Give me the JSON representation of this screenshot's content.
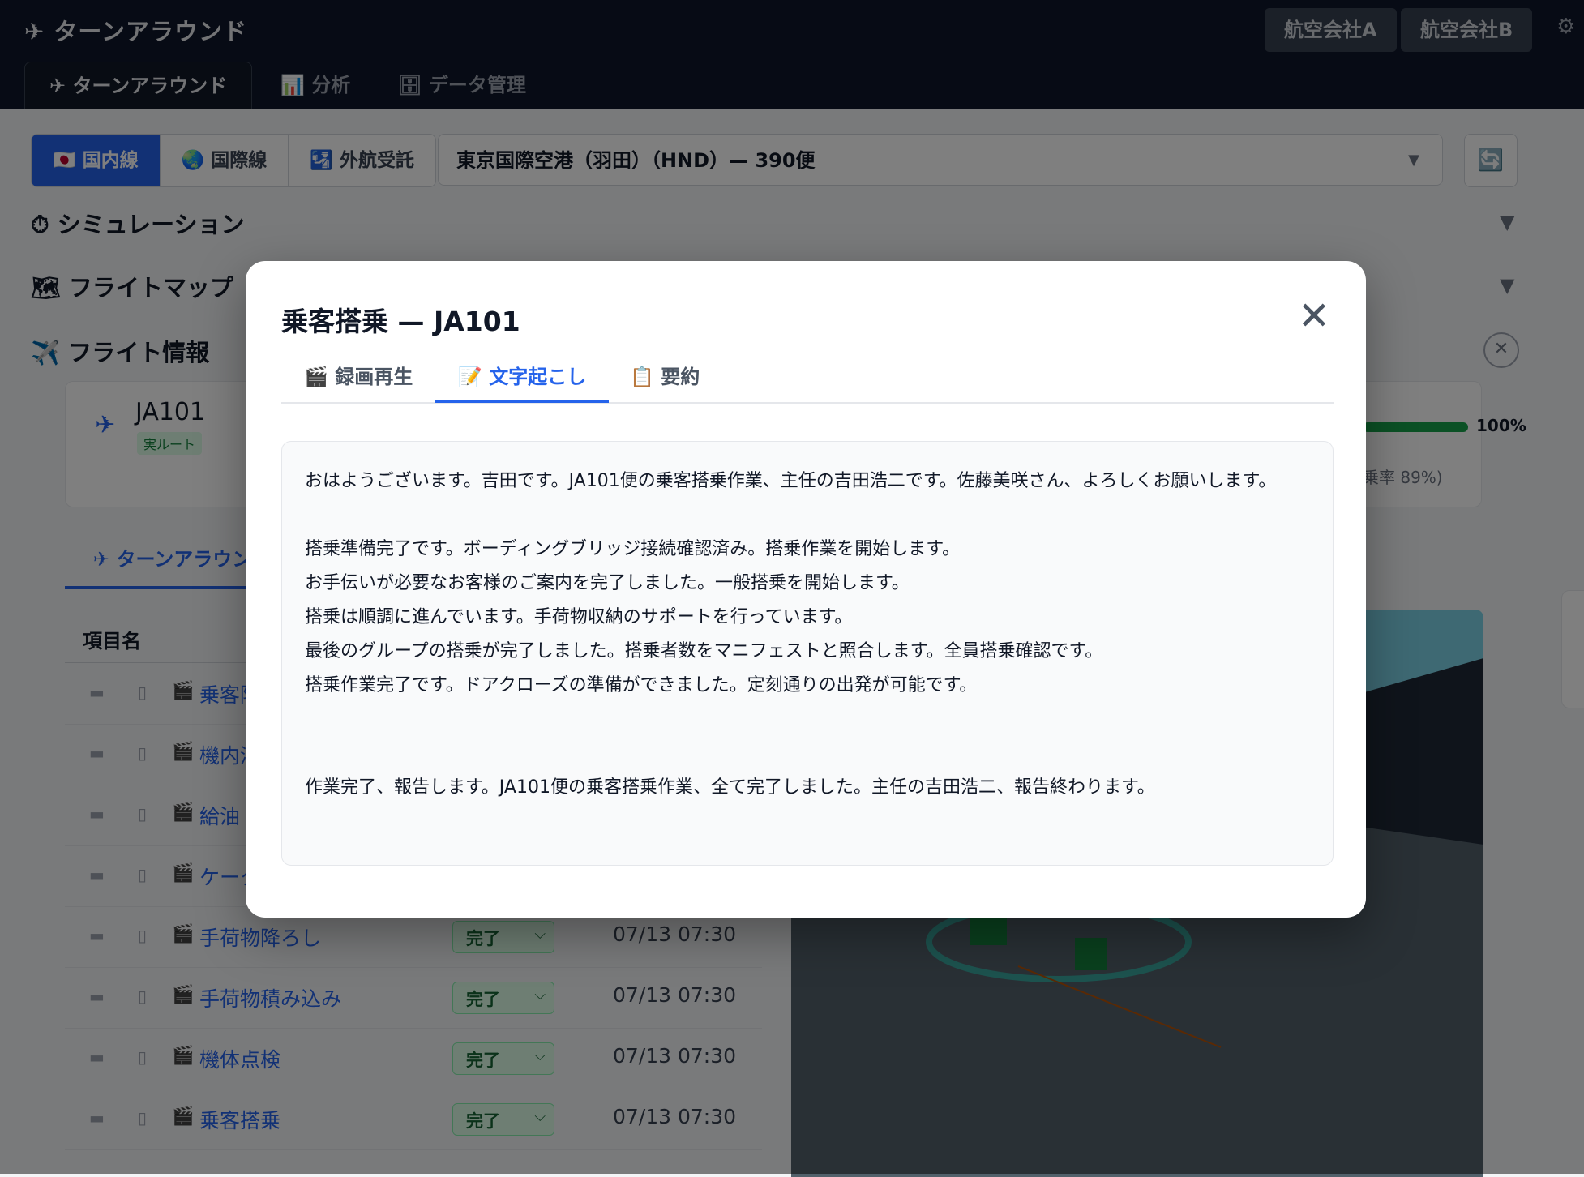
{
  "header": {
    "app_title": "✈ ターンアラウンド",
    "airline_a": "航空会社A",
    "airline_b": "航空会社B",
    "settings_icon": "⚙",
    "nav_tabs": [
      {
        "label": "✈ ターンアラウンド"
      },
      {
        "label": "📊 分析"
      },
      {
        "label": "🗄 データ管理"
      }
    ]
  },
  "filters": {
    "route_types": [
      "🇯🇵 国内線",
      "🌏 国際線",
      "🛂 外航受託"
    ],
    "airport": "東京国際空港（羽田）（HND）— 390便",
    "airport_caret": "▼",
    "refresh_icon": "🔄"
  },
  "sections": {
    "simulation": "⏱ シミュレーション",
    "flight_map": "🗺 フライトマップ",
    "flight_info": "✈️ フライト情報",
    "caret": "▼",
    "close": "✕"
  },
  "flight_card": {
    "plane_icon": "✈",
    "flight_no": "JA101",
    "route_badge": "実ルート",
    "progress_pct": "100%",
    "progress_value": 1.0,
    "load_factor": "乗率 89%)"
  },
  "subtab": "✈ ターンアラウン",
  "table": {
    "header": "項目名",
    "rows": [
      {
        "name": "乗客降",
        "status": "",
        "time": ""
      },
      {
        "name": "機内清",
        "status": "",
        "time": ""
      },
      {
        "name": "給油",
        "status": "",
        "time": ""
      },
      {
        "name": "ケータ",
        "status": "",
        "time": ""
      },
      {
        "name": "手荷物降ろし",
        "status": "完了",
        "time": "07/13 07:30"
      },
      {
        "name": "手荷物積み込み",
        "status": "完了",
        "time": "07/13 07:30"
      },
      {
        "name": "機体点検",
        "status": "完了",
        "time": "07/13 07:30"
      },
      {
        "name": "乗客搭乗",
        "status": "完了",
        "time": "07/13 07:30"
      }
    ]
  },
  "modal": {
    "title": "乗客搭乗 — JA101",
    "close_icon": "✕",
    "tabs": [
      "🎬 録画再生",
      "📝 文字起こし",
      "📋 要約"
    ],
    "transcript": {
      "intro": "おはようございます。吉田です。JA101便の乗客搭乗作業、主任の吉田浩二です。佐藤美咲さん、よろしくお願いします。",
      "lines": [
        "搭乗準備完了です。ボーディングブリッジ接続確認済み。搭乗作業を開始します。",
        "お手伝いが必要なお客様のご案内を完了しました。一般搭乗を開始します。",
        "搭乗は順調に進んでいます。手荷物収納のサポートを行っています。",
        "最後のグループの搭乗が完了しました。搭乗者数をマニフェストと照合します。全員搭乗確認です。",
        "搭乗作業完了です。ドアクローズの準備ができました。定刻通りの出発が可能です。"
      ],
      "closing": "作業完了、報告します。JA101便の乗客搭乗作業、全て完了しました。主任の吉田浩二、報告終わります。"
    }
  }
}
